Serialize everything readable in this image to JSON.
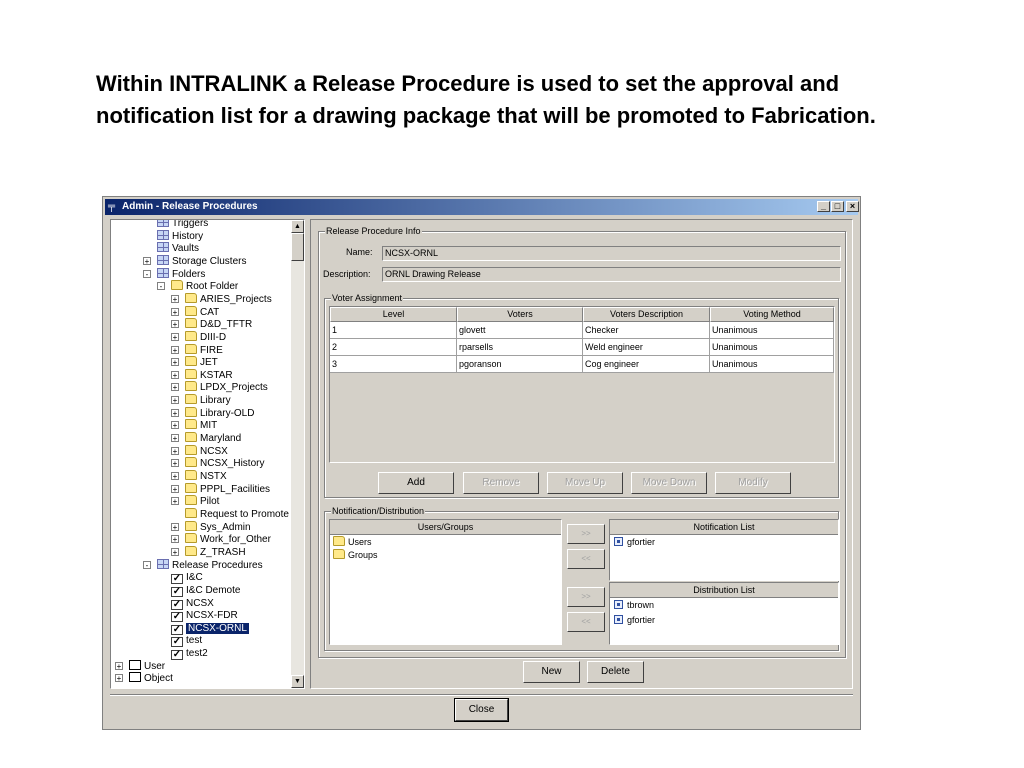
{
  "heading": "Within INTRALINK a Release Procedure is used to set the approval and notification list for a drawing package that will be promoted to Fabrication.",
  "window": {
    "title": "Admin - Release Procedures",
    "minimize": "_",
    "maximize": "□",
    "close": "×"
  },
  "tree": {
    "items": [
      {
        "label": "Triggers",
        "icon": "table-icon"
      },
      {
        "label": "History",
        "icon": "table-icon"
      },
      {
        "label": "Vaults",
        "icon": "table-icon"
      },
      {
        "label": "Storage Clusters",
        "icon": "table-icon"
      },
      {
        "label": "Folders",
        "icon": "table-icon"
      },
      {
        "label": "Root Folder",
        "icon": "folder-icon"
      },
      {
        "label": "ARIES_Projects",
        "icon": "folder-icon"
      },
      {
        "label": "CAT",
        "icon": "folder-icon"
      },
      {
        "label": "D&D_TFTR",
        "icon": "folder-icon"
      },
      {
        "label": "DIII-D",
        "icon": "folder-icon"
      },
      {
        "label": "FIRE",
        "icon": "folder-icon"
      },
      {
        "label": "JET",
        "icon": "folder-icon"
      },
      {
        "label": "KSTAR",
        "icon": "folder-icon"
      },
      {
        "label": "LPDX_Projects",
        "icon": "folder-icon"
      },
      {
        "label": "Library",
        "icon": "folder-icon"
      },
      {
        "label": "Library-OLD",
        "icon": "folder-icon"
      },
      {
        "label": "MIT",
        "icon": "folder-icon"
      },
      {
        "label": "Maryland",
        "icon": "folder-icon"
      },
      {
        "label": "NCSX",
        "icon": "folder-icon"
      },
      {
        "label": "NCSX_History",
        "icon": "folder-icon"
      },
      {
        "label": "NSTX",
        "icon": "folder-icon"
      },
      {
        "label": "PPPL_Facilities",
        "icon": "folder-icon"
      },
      {
        "label": "Pilot",
        "icon": "folder-icon"
      },
      {
        "label": "Request to Promote",
        "icon": "folder-icon"
      },
      {
        "label": "Sys_Admin",
        "icon": "folder-icon"
      },
      {
        "label": "Work_for_Other",
        "icon": "folder-icon"
      },
      {
        "label": "Z_TRASH",
        "icon": "folder-icon"
      },
      {
        "label": "Release Procedures",
        "icon": "table-icon"
      },
      {
        "label": "I&C",
        "icon": "check-icon"
      },
      {
        "label": "I&C Demote",
        "icon": "check-icon"
      },
      {
        "label": "NCSX",
        "icon": "check-icon"
      },
      {
        "label": "NCSX-FDR",
        "icon": "check-icon"
      },
      {
        "label": "NCSX-ORNL",
        "icon": "check-icon",
        "selected": true
      },
      {
        "label": "test",
        "icon": "check-icon"
      },
      {
        "label": "test2",
        "icon": "check-icon"
      },
      {
        "label": "User",
        "icon": "box-icon"
      },
      {
        "label": "Object",
        "icon": "box-icon"
      }
    ]
  },
  "info": {
    "group_label": "Release Procedure Info",
    "name_label": "Name:",
    "name_value": "NCSX-ORNL",
    "description_label": "Description:",
    "description_value": "ORNL Drawing Release"
  },
  "voters": {
    "group_label": "Voter Assignment",
    "columns": [
      "Level",
      "Voters",
      "Voters Description",
      "Voting Method"
    ],
    "rows": [
      [
        "1",
        "glovett",
        "Checker",
        "Unanimous"
      ],
      [
        "2",
        "rparsells",
        "Weld engineer",
        "Unanimous"
      ],
      [
        "3",
        "pgoranson",
        "Cog engineer",
        "Unanimous"
      ]
    ],
    "buttons": {
      "add": "Add",
      "remove": "Remove",
      "move_up": "Move Up",
      "move_down": "Move Down",
      "modify": "Modify"
    }
  },
  "notification": {
    "group_label": "Notification/Distribution",
    "users_groups_header": "Users/Groups",
    "users_groups": [
      "Users",
      "Groups"
    ],
    "notification_header": "Notification List",
    "notification_list": [
      "gfortier"
    ],
    "distribution_header": "Distribution List",
    "distribution_list": [
      "tbrown",
      "gfortier"
    ],
    "add_arrow": ">>",
    "remove_arrow": "<<"
  },
  "actions": {
    "new": "New",
    "delete": "Delete",
    "close": "Close"
  }
}
